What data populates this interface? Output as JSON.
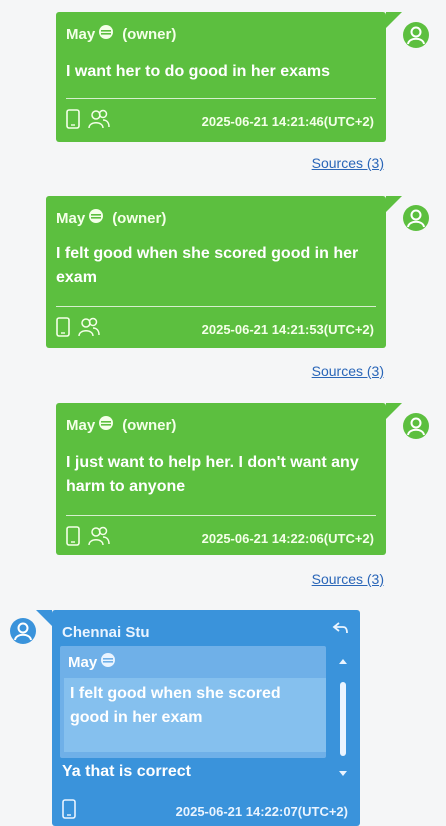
{
  "messages": [
    {
      "sender": "May",
      "role": "(owner)",
      "text": "I want her to do good in her exams",
      "time": "2025-06-21 14:21:46(UTC+2)",
      "sources": "Sources (3)"
    },
    {
      "sender": "May",
      "role": "(owner)",
      "text": "I felt good when she scored good in her exam",
      "time": "2025-06-21 14:21:53(UTC+2)",
      "sources": "Sources (3)"
    },
    {
      "sender": "May",
      "role": "(owner)",
      "text": "I just want to help her. I don't want any harm to anyone",
      "time": "2025-06-21 14:22:06(UTC+2)",
      "sources": "Sources (3)"
    }
  ],
  "reply": {
    "sender": "Chennai Stu",
    "quoted_sender": "May",
    "quoted_text": "I felt good when she scored good in her exam",
    "text": "Ya that is correct",
    "time": "2025-06-21 14:22:07(UTC+2)"
  },
  "colors": {
    "owner_bubble": "#5cbf3f",
    "reply_bubble": "#3a93db",
    "link": "#2a66b8",
    "background": "#f5f6f7"
  },
  "icons": [
    "user-avatar-icon",
    "emoji-icon",
    "phone-icon",
    "contacts-icon",
    "reply-icon",
    "scroll-up-icon",
    "scroll-down-icon"
  ]
}
